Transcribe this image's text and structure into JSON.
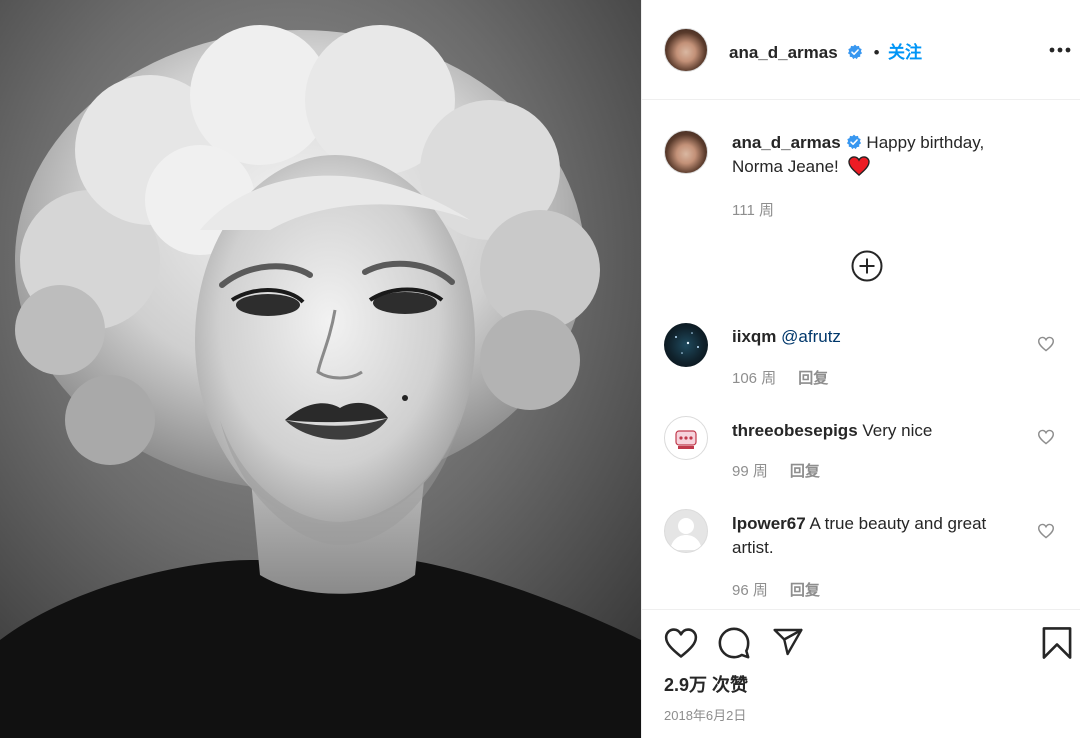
{
  "post": {
    "author": "ana_d_armas",
    "follow_label": "关注",
    "dot": "•"
  },
  "caption": {
    "username": "ana_d_armas",
    "text_line1": "Happy birthday,",
    "text_line2": "Norma Jeane!",
    "emoji": "❤️",
    "time": "111 周"
  },
  "comments": [
    {
      "username": "iixqm",
      "text": "@afrutz",
      "time": "106 周",
      "reply_label": "回复"
    },
    {
      "username": "threeobesepigs",
      "text": "Very nice",
      "time": "99 周",
      "reply_label": "回复"
    },
    {
      "username": "lpower67",
      "text_line1": "A true beauty and great",
      "text_line2": "artist.",
      "time": "96 周",
      "reply_label": "回复"
    }
  ],
  "likes": "2.9万 次赞",
  "date": "2018年6月2日",
  "icons": {
    "more": "more-options-icon",
    "load_more": "plus-circle-icon",
    "like": "heart-icon",
    "comment": "comment-icon",
    "share": "paper-plane-icon",
    "save": "bookmark-icon",
    "verified": "verified-badge-icon"
  },
  "colors": {
    "accent": "#0095f6",
    "verified": "#3897f0",
    "text": "#262626",
    "secondary": "#8e8e8e",
    "mention": "#00376b",
    "heart_red": "#ed1c24"
  }
}
